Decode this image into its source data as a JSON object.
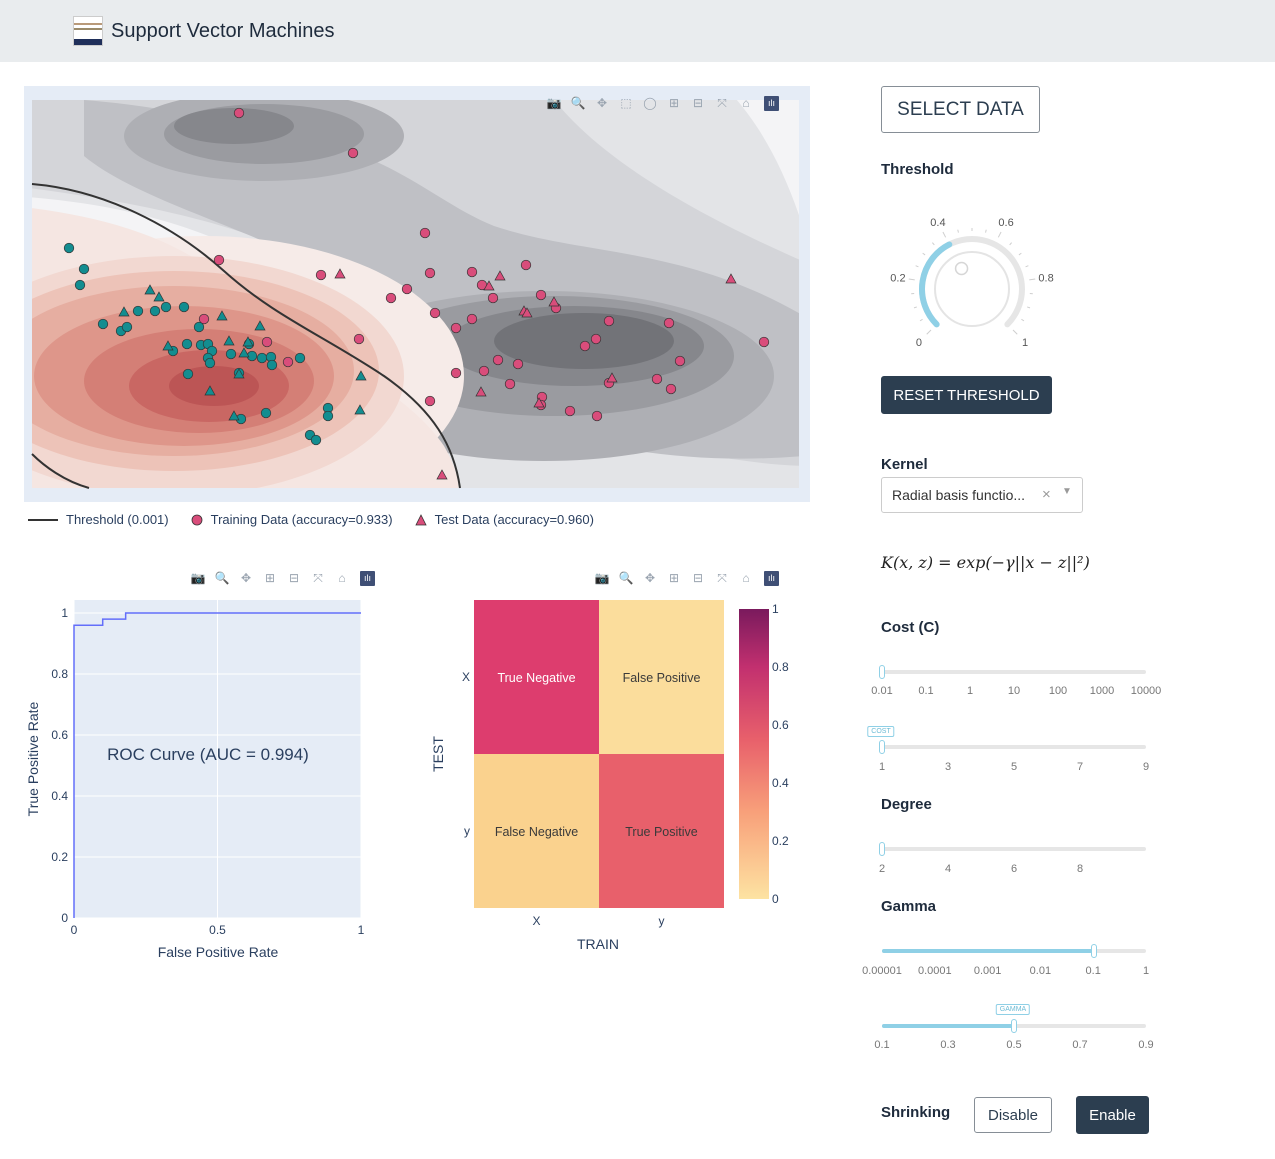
{
  "app": {
    "title": "Support Vector Machines",
    "logo_icon": "logo-icon"
  },
  "main_plot": {
    "legend": {
      "threshold": "Threshold (0.001)",
      "training": "Training Data (accuracy=0.933)",
      "test": "Test Data (accuracy=0.960)"
    },
    "colors": {
      "class_a": "#d94d7b",
      "class_b": "#138d90",
      "contour_dark": "#6b6c70",
      "contour_red": "#c24a55"
    },
    "training_points": [
      {
        "x": 239,
        "y": 113,
        "c": "a"
      },
      {
        "x": 353,
        "y": 153,
        "c": "a"
      },
      {
        "x": 425,
        "y": 233,
        "c": "a"
      },
      {
        "x": 219,
        "y": 260,
        "c": "a"
      },
      {
        "x": 321,
        "y": 275,
        "c": "a"
      },
      {
        "x": 430,
        "y": 273,
        "c": "a"
      },
      {
        "x": 472,
        "y": 272,
        "c": "a"
      },
      {
        "x": 526,
        "y": 265,
        "c": "a"
      },
      {
        "x": 482,
        "y": 285,
        "c": "a"
      },
      {
        "x": 391,
        "y": 298,
        "c": "a"
      },
      {
        "x": 407,
        "y": 289,
        "c": "a"
      },
      {
        "x": 493,
        "y": 298,
        "c": "a"
      },
      {
        "x": 541,
        "y": 295,
        "c": "a"
      },
      {
        "x": 435,
        "y": 313,
        "c": "a"
      },
      {
        "x": 456,
        "y": 328,
        "c": "a"
      },
      {
        "x": 472,
        "y": 319,
        "c": "a"
      },
      {
        "x": 556,
        "y": 308,
        "c": "a"
      },
      {
        "x": 609,
        "y": 321,
        "c": "a"
      },
      {
        "x": 669,
        "y": 323,
        "c": "a"
      },
      {
        "x": 764,
        "y": 342,
        "c": "a"
      },
      {
        "x": 596,
        "y": 339,
        "c": "a"
      },
      {
        "x": 585,
        "y": 346,
        "c": "a"
      },
      {
        "x": 359,
        "y": 339,
        "c": "a"
      },
      {
        "x": 498,
        "y": 360,
        "c": "a"
      },
      {
        "x": 518,
        "y": 364,
        "c": "a"
      },
      {
        "x": 456,
        "y": 373,
        "c": "a"
      },
      {
        "x": 484,
        "y": 371,
        "c": "a"
      },
      {
        "x": 510,
        "y": 384,
        "c": "a"
      },
      {
        "x": 680,
        "y": 361,
        "c": "a"
      },
      {
        "x": 657,
        "y": 379,
        "c": "a"
      },
      {
        "x": 671,
        "y": 389,
        "c": "a"
      },
      {
        "x": 609,
        "y": 383,
        "c": "a"
      },
      {
        "x": 542,
        "y": 397,
        "c": "a"
      },
      {
        "x": 541,
        "y": 405,
        "c": "a"
      },
      {
        "x": 430,
        "y": 401,
        "c": "a"
      },
      {
        "x": 570,
        "y": 411,
        "c": "a"
      },
      {
        "x": 597,
        "y": 416,
        "c": "a"
      },
      {
        "x": 204,
        "y": 319,
        "c": "a"
      },
      {
        "x": 267,
        "y": 342,
        "c": "a"
      },
      {
        "x": 288,
        "y": 362,
        "c": "a"
      },
      {
        "x": 69,
        "y": 248,
        "c": "b"
      },
      {
        "x": 84,
        "y": 269,
        "c": "b"
      },
      {
        "x": 80,
        "y": 285,
        "c": "b"
      },
      {
        "x": 103,
        "y": 324,
        "c": "b"
      },
      {
        "x": 121,
        "y": 331,
        "c": "b"
      },
      {
        "x": 127,
        "y": 327,
        "c": "b"
      },
      {
        "x": 138,
        "y": 311,
        "c": "b"
      },
      {
        "x": 155,
        "y": 311,
        "c": "b"
      },
      {
        "x": 166,
        "y": 307,
        "c": "b"
      },
      {
        "x": 184,
        "y": 307,
        "c": "b"
      },
      {
        "x": 199,
        "y": 327,
        "c": "b"
      },
      {
        "x": 173,
        "y": 351,
        "c": "b"
      },
      {
        "x": 187,
        "y": 344,
        "c": "b"
      },
      {
        "x": 201,
        "y": 345,
        "c": "b"
      },
      {
        "x": 208,
        "y": 344,
        "c": "b"
      },
      {
        "x": 212,
        "y": 351,
        "c": "b"
      },
      {
        "x": 231,
        "y": 354,
        "c": "b"
      },
      {
        "x": 249,
        "y": 344,
        "c": "b"
      },
      {
        "x": 208,
        "y": 358,
        "c": "b"
      },
      {
        "x": 210,
        "y": 363,
        "c": "b"
      },
      {
        "x": 252,
        "y": 356,
        "c": "b"
      },
      {
        "x": 262,
        "y": 358,
        "c": "b"
      },
      {
        "x": 271,
        "y": 357,
        "c": "b"
      },
      {
        "x": 272,
        "y": 365,
        "c": "b"
      },
      {
        "x": 300,
        "y": 358,
        "c": "b"
      },
      {
        "x": 188,
        "y": 374,
        "c": "b"
      },
      {
        "x": 239,
        "y": 373,
        "c": "b"
      },
      {
        "x": 328,
        "y": 408,
        "c": "b"
      },
      {
        "x": 328,
        "y": 416,
        "c": "b"
      },
      {
        "x": 266,
        "y": 413,
        "c": "b"
      },
      {
        "x": 241,
        "y": 419,
        "c": "b"
      },
      {
        "x": 310,
        "y": 435,
        "c": "b"
      },
      {
        "x": 316,
        "y": 440,
        "c": "b"
      }
    ],
    "test_points": [
      {
        "x": 340,
        "y": 274,
        "c": "a"
      },
      {
        "x": 500,
        "y": 276,
        "c": "a"
      },
      {
        "x": 489,
        "y": 286,
        "c": "a"
      },
      {
        "x": 554,
        "y": 302,
        "c": "a"
      },
      {
        "x": 524,
        "y": 311,
        "c": "a"
      },
      {
        "x": 527,
        "y": 313,
        "c": "a"
      },
      {
        "x": 731,
        "y": 279,
        "c": "a"
      },
      {
        "x": 612,
        "y": 378,
        "c": "a"
      },
      {
        "x": 481,
        "y": 392,
        "c": "a"
      },
      {
        "x": 539,
        "y": 403,
        "c": "a"
      },
      {
        "x": 442,
        "y": 475,
        "c": "a"
      },
      {
        "x": 150,
        "y": 290,
        "c": "b"
      },
      {
        "x": 159,
        "y": 297,
        "c": "b"
      },
      {
        "x": 124,
        "y": 312,
        "c": "b"
      },
      {
        "x": 222,
        "y": 316,
        "c": "b"
      },
      {
        "x": 260,
        "y": 326,
        "c": "b"
      },
      {
        "x": 168,
        "y": 346,
        "c": "b"
      },
      {
        "x": 229,
        "y": 341,
        "c": "b"
      },
      {
        "x": 248,
        "y": 342,
        "c": "b"
      },
      {
        "x": 244,
        "y": 353,
        "c": "b"
      },
      {
        "x": 361,
        "y": 376,
        "c": "b"
      },
      {
        "x": 210,
        "y": 391,
        "c": "b"
      },
      {
        "x": 239,
        "y": 374,
        "c": "b"
      },
      {
        "x": 360,
        "y": 410,
        "c": "b"
      },
      {
        "x": 234,
        "y": 416,
        "c": "b"
      }
    ]
  },
  "roc": {
    "chart_data": {
      "type": "line",
      "title": "ROC Curve (AUC = 0.994)",
      "xlabel": "False Positive Rate",
      "ylabel": "True Positive Rate",
      "xlim": [
        0,
        1
      ],
      "ylim": [
        0,
        1
      ],
      "x": [
        0,
        0,
        0.1,
        0.1,
        0.18,
        0.18,
        1
      ],
      "y": [
        0,
        0.96,
        0.96,
        0.98,
        0.98,
        1,
        1
      ],
      "xticks": [
        "0",
        "0.5",
        "1"
      ],
      "yticks": [
        "0",
        "0.2",
        "0.4",
        "0.6",
        "0.8",
        "1"
      ]
    }
  },
  "confusion": {
    "chart_data": {
      "type": "heatmap",
      "xlabel": "TRAIN",
      "ylabel": "TEST",
      "x_categories": [
        "X",
        "y"
      ],
      "y_categories": [
        "X",
        "y"
      ],
      "cells": [
        {
          "label": "True Negative",
          "value": 0.52,
          "color": "#dd3d6e",
          "text_color": "#ffffff"
        },
        {
          "label": "False Positive",
          "value": 0.04,
          "color": "#fbdd9c",
          "text_color": "#3a3a3a"
        },
        {
          "label": "False Negative",
          "value": 0.08,
          "color": "#fad28e",
          "text_color": "#3a3a3a"
        },
        {
          "label": "True Positive",
          "value": 0.42,
          "color": "#e8606b",
          "text_color": "#3a3a3a"
        }
      ],
      "colorbar_ticks": [
        "0",
        "0.2",
        "0.4",
        "0.6",
        "0.8",
        "1"
      ]
    }
  },
  "controls": {
    "select_data_label": "SELECT DATA",
    "threshold_label": "Threshold",
    "knob_ticks": [
      "0",
      "0.2",
      "0.4",
      "0.6",
      "0.8",
      "1"
    ],
    "threshold_value": 0.4,
    "reset_label": "RESET THRESHOLD",
    "kernel_label": "Kernel",
    "kernel_value": "Radial basis functio...",
    "formula": "K(x, z) = exp(−γ||x − z||²)",
    "cost_label": "Cost (C)",
    "cost_ticks": [
      "0.01",
      "0.1",
      "1",
      "10",
      "100",
      "1000",
      "10000"
    ],
    "cost_mult_ticks": [
      "1",
      "3",
      "5",
      "7",
      "9"
    ],
    "cost_badge": "COST",
    "degree_label": "Degree",
    "degree_ticks": [
      "2",
      "4",
      "6",
      "8"
    ],
    "gamma_label": "Gamma",
    "gamma_ticks": [
      "0.00001",
      "0.0001",
      "0.001",
      "0.01",
      "0.1",
      "1"
    ],
    "gamma_mult_ticks": [
      "0.1",
      "0.3",
      "0.5",
      "0.7",
      "0.9"
    ],
    "gamma_badge": "GAMMA",
    "shrinking_label": "Shrinking",
    "disable_label": "Disable",
    "enable_label": "Enable"
  }
}
